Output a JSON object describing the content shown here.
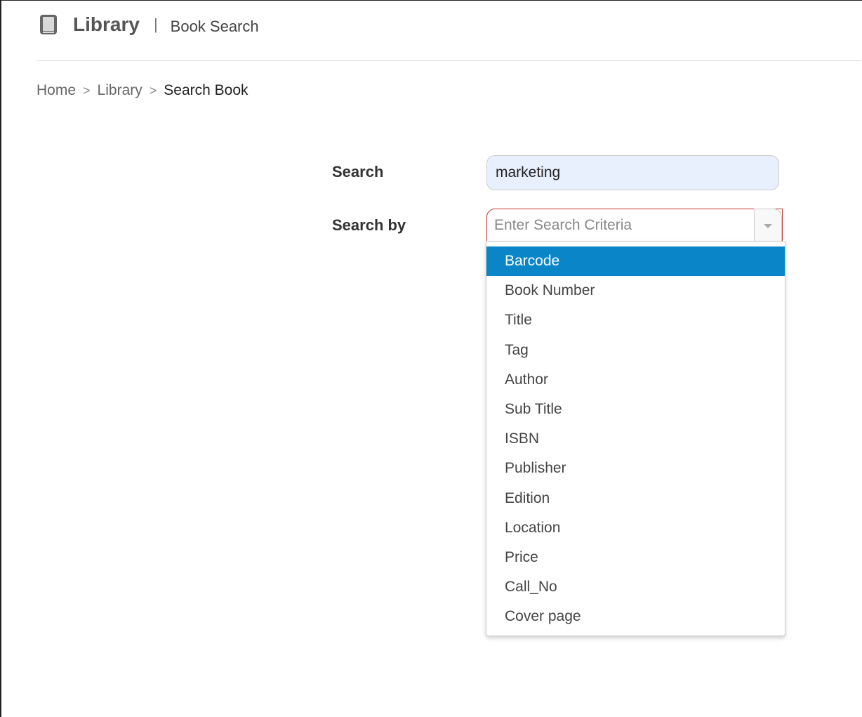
{
  "header": {
    "app_title": "Library",
    "separator": "|",
    "page_subtitle": "Book Search",
    "icon": "book-icon"
  },
  "breadcrumb": {
    "items": [
      {
        "label": "Home"
      },
      {
        "label": "Library"
      },
      {
        "label": "Search Book"
      }
    ],
    "separator": ">"
  },
  "form": {
    "search_label": "Search",
    "search_value": "marketing",
    "search_by_label": "Search by",
    "search_by_placeholder": "Enter Search Criteria",
    "search_by_value": ""
  },
  "dropdown": {
    "highlighted_index": 0,
    "highlight_color": "#0a86c8",
    "options": [
      "Barcode",
      "Book Number",
      "Title",
      "Tag",
      "Author",
      "Sub Title",
      "ISBN",
      "Publisher",
      "Edition",
      "Location",
      "Price",
      "Call_No",
      "Cover page"
    ]
  }
}
